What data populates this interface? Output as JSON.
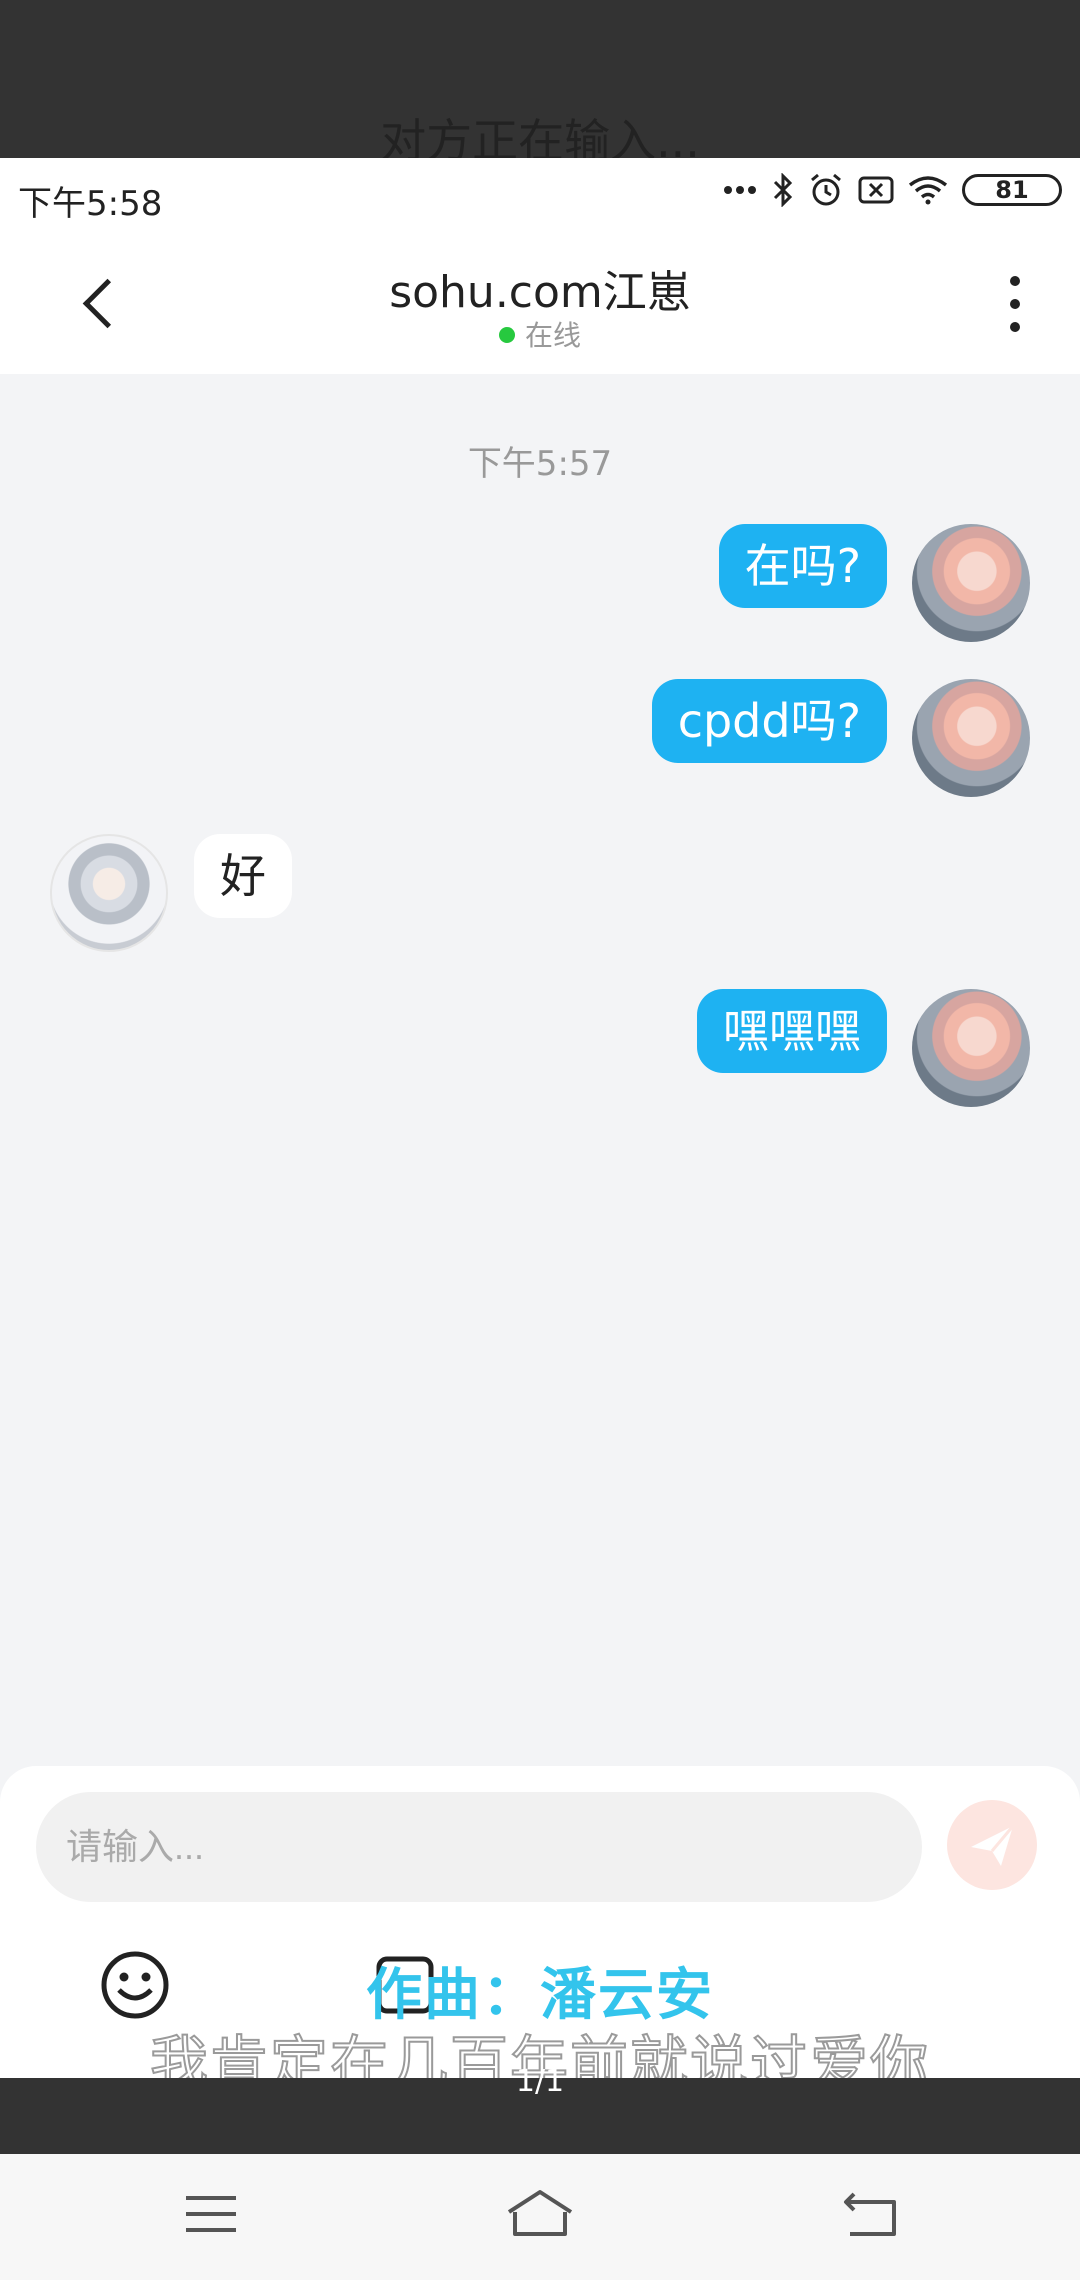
{
  "overlay": {
    "typing_title": "对方正在输入...",
    "lyric_composer": "作曲：潘云安",
    "lyric_line": "我肯定在几百年前就说过爱你",
    "page_indicator": "1/1"
  },
  "status_bar": {
    "time": "下午5:58",
    "battery": "81",
    "icons": [
      "signal-dots-icon",
      "bluetooth-icon",
      "alarm-icon",
      "sim-off-icon",
      "wifi-icon",
      "battery-icon"
    ]
  },
  "header": {
    "title": "sohu.com江崽",
    "status": "在线",
    "status_color": "#27c93f"
  },
  "chat": {
    "timestamp": "下午5:57",
    "messages": [
      {
        "direction": "out",
        "text": "在吗?"
      },
      {
        "direction": "out",
        "text": "cpdd吗?"
      },
      {
        "direction": "in",
        "text": "好"
      },
      {
        "direction": "out",
        "text": "嘿嘿嘿"
      }
    ]
  },
  "input": {
    "placeholder": "请输入..."
  },
  "colors": {
    "outgoing_bubble": "#1eb2f2",
    "background": "#f3f4f6",
    "send_button": "#fde5e0"
  },
  "nav": {
    "icons": [
      "menu-icon",
      "home-icon",
      "back-icon"
    ]
  }
}
